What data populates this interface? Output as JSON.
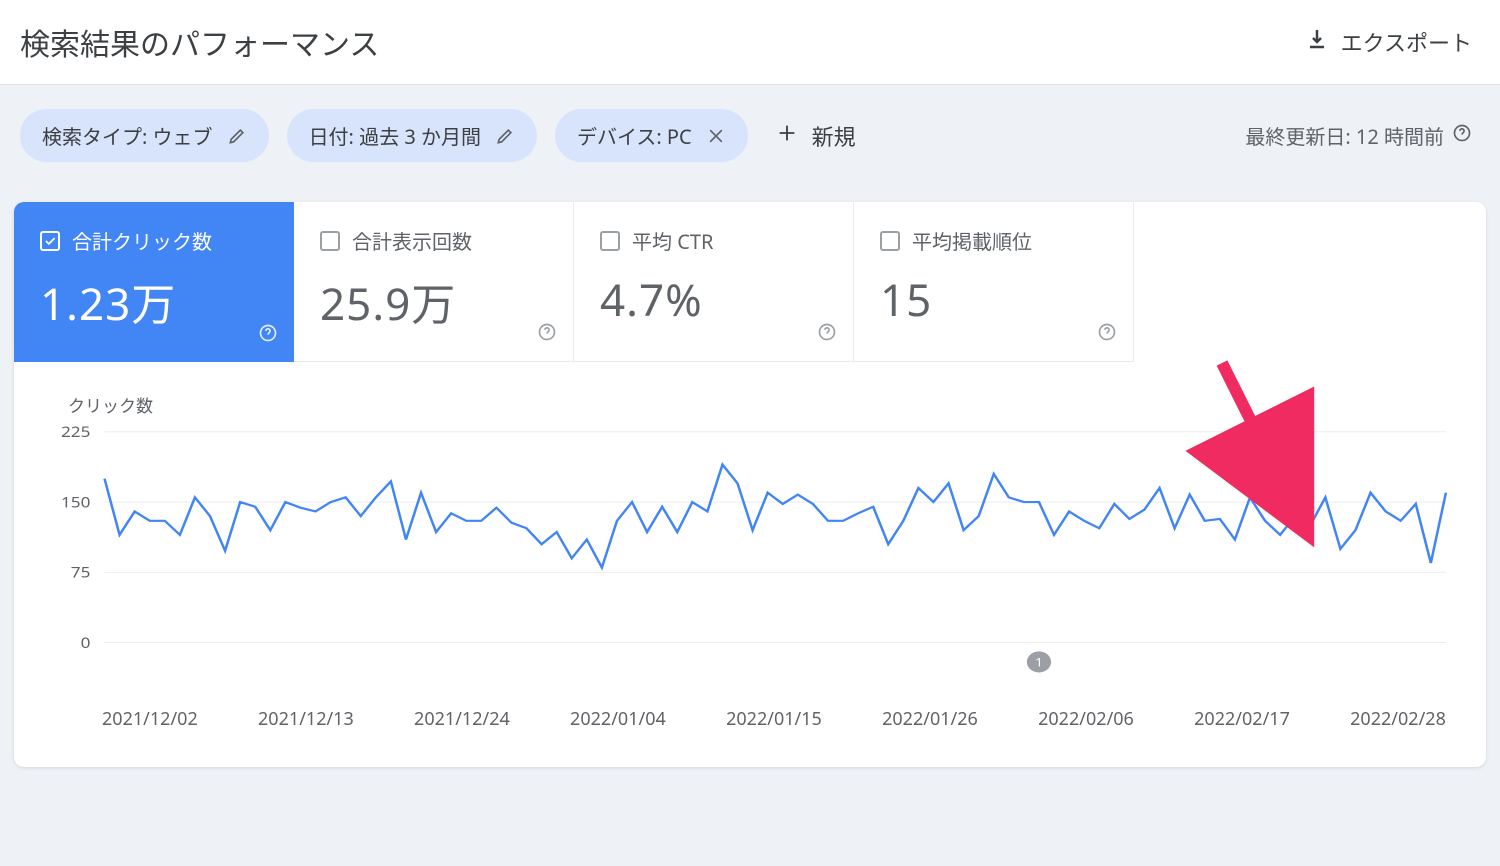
{
  "header": {
    "title": "検索結果のパフォーマンス",
    "export_label": "エクスポート"
  },
  "filters": {
    "chips": [
      {
        "label": "検索タイプ: ウェブ",
        "action": "edit"
      },
      {
        "label": "日付: 過去 3 か月間",
        "action": "edit"
      },
      {
        "label": "デバイス: PC",
        "action": "close"
      }
    ],
    "new_label": "新規",
    "updated_label": "最終更新日: 12 時間前"
  },
  "metrics": [
    {
      "label": "合計クリック数",
      "value": "1.23万",
      "selected": true
    },
    {
      "label": "合計表示回数",
      "value": "25.9万",
      "selected": false
    },
    {
      "label": "平均 CTR",
      "value": "4.7%",
      "selected": false
    },
    {
      "label": "平均掲載順位",
      "value": "15",
      "selected": false
    }
  ],
  "chart_data": {
    "type": "line",
    "title": "クリック数",
    "ylabel": "クリック数",
    "ylim": [
      0,
      225
    ],
    "yticks": [
      0,
      75,
      150,
      225
    ],
    "x_tick_labels": [
      "2021/12/02",
      "2021/12/13",
      "2021/12/24",
      "2022/01/04",
      "2022/01/15",
      "2022/01/26",
      "2022/02/06",
      "2022/02/17",
      "2022/02/28"
    ],
    "series": [
      {
        "name": "クリック数",
        "color": "#4285f4",
        "values": [
          175,
          115,
          140,
          130,
          130,
          115,
          155,
          135,
          98,
          150,
          145,
          120,
          150,
          144,
          140,
          150,
          155,
          135,
          155,
          172,
          110,
          160,
          118,
          138,
          130,
          130,
          144,
          128,
          122,
          105,
          118,
          90,
          110,
          80,
          130,
          150,
          118,
          145,
          118,
          150,
          140,
          190,
          170,
          120,
          160,
          148,
          158,
          148,
          130,
          130,
          138,
          145,
          105,
          130,
          165,
          150,
          170,
          120,
          135,
          180,
          155,
          150,
          150,
          115,
          140,
          130,
          122,
          148,
          132,
          142,
          165,
          122,
          158,
          130,
          132,
          110,
          155,
          130,
          115,
          135,
          125,
          155,
          100,
          120,
          160,
          140,
          130,
          148,
          85,
          160
        ]
      }
    ],
    "note_marker": {
      "index": 62,
      "text": "1"
    }
  }
}
